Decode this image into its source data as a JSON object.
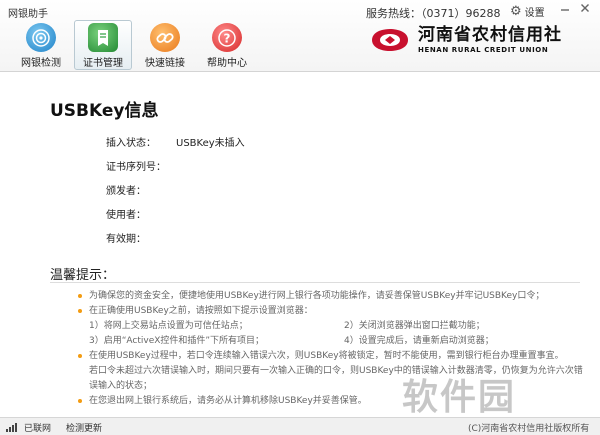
{
  "window": {
    "title": "网银助手",
    "minimize_icon": "minimize-icon",
    "close_icon": "close-icon"
  },
  "header": {
    "hotline": "服务热线：（0371）96288",
    "settings_label": "设置",
    "settings_icon": "gear-icon"
  },
  "nav": [
    {
      "label": "网银检测",
      "icon": "radar-icon",
      "color": "#3aa0dd",
      "active": false
    },
    {
      "label": "证书管理",
      "icon": "certificate-icon",
      "color": "#2e9e3e",
      "active": true
    },
    {
      "label": "快速链接",
      "icon": "link-icon",
      "color": "#f08a24",
      "active": false
    },
    {
      "label": "帮助中心",
      "icon": "help-icon",
      "color": "#e23b3b",
      "active": false
    }
  ],
  "logo": {
    "cn": "河南省农村信用社",
    "en": "HENAN RURAL CREDIT UNION",
    "color": "#c8102e"
  },
  "main": {
    "title": "USBKey信息",
    "fields": [
      {
        "label": "插入状态：",
        "value": "USBKey未插入"
      },
      {
        "label": "证书序列号：",
        "value": ""
      },
      {
        "label": "颁发者：",
        "value": ""
      },
      {
        "label": "使用者：",
        "value": ""
      },
      {
        "label": "有效期：",
        "value": ""
      }
    ]
  },
  "tips": {
    "title": "温馨提示：",
    "items": [
      "为确保您的资金安全，便捷地使用USBKey进行网上银行各项功能操作，请妥善保管USBKey并牢记USBKey口令；",
      "在正确使用USBKey之前，请按照如下提示设置浏览器：",
      "在使用USBKey过程中，若口令连续输入错误六次，则USBKey将被锁定，暂时不能使用，需到银行柜台办理重置事宜。",
      "在您退出网上银行系统后，请务必从计算机移除USBKey并妥善保管。"
    ],
    "sub": [
      "1）将网上交易站点设置为可信任站点；",
      "2）关闭浏览器弹出窗口拦截功能；",
      "3）启用“ActiveX控件和插件”下所有项目；",
      "4）设置完成后，请重新启动浏览器；"
    ],
    "cont": "若口令未超过六次错误输入时，期间只要有一次输入正确的口令，则USBKey中的错误输入计数器清零，仍恢复为允许六次错误输入的状态；"
  },
  "watermark": "软件园",
  "status": {
    "network": "已联网",
    "update": "检测更新",
    "copyright": "(C)河南省农村信用社版权所有",
    "signal_icon": "signal-icon"
  }
}
